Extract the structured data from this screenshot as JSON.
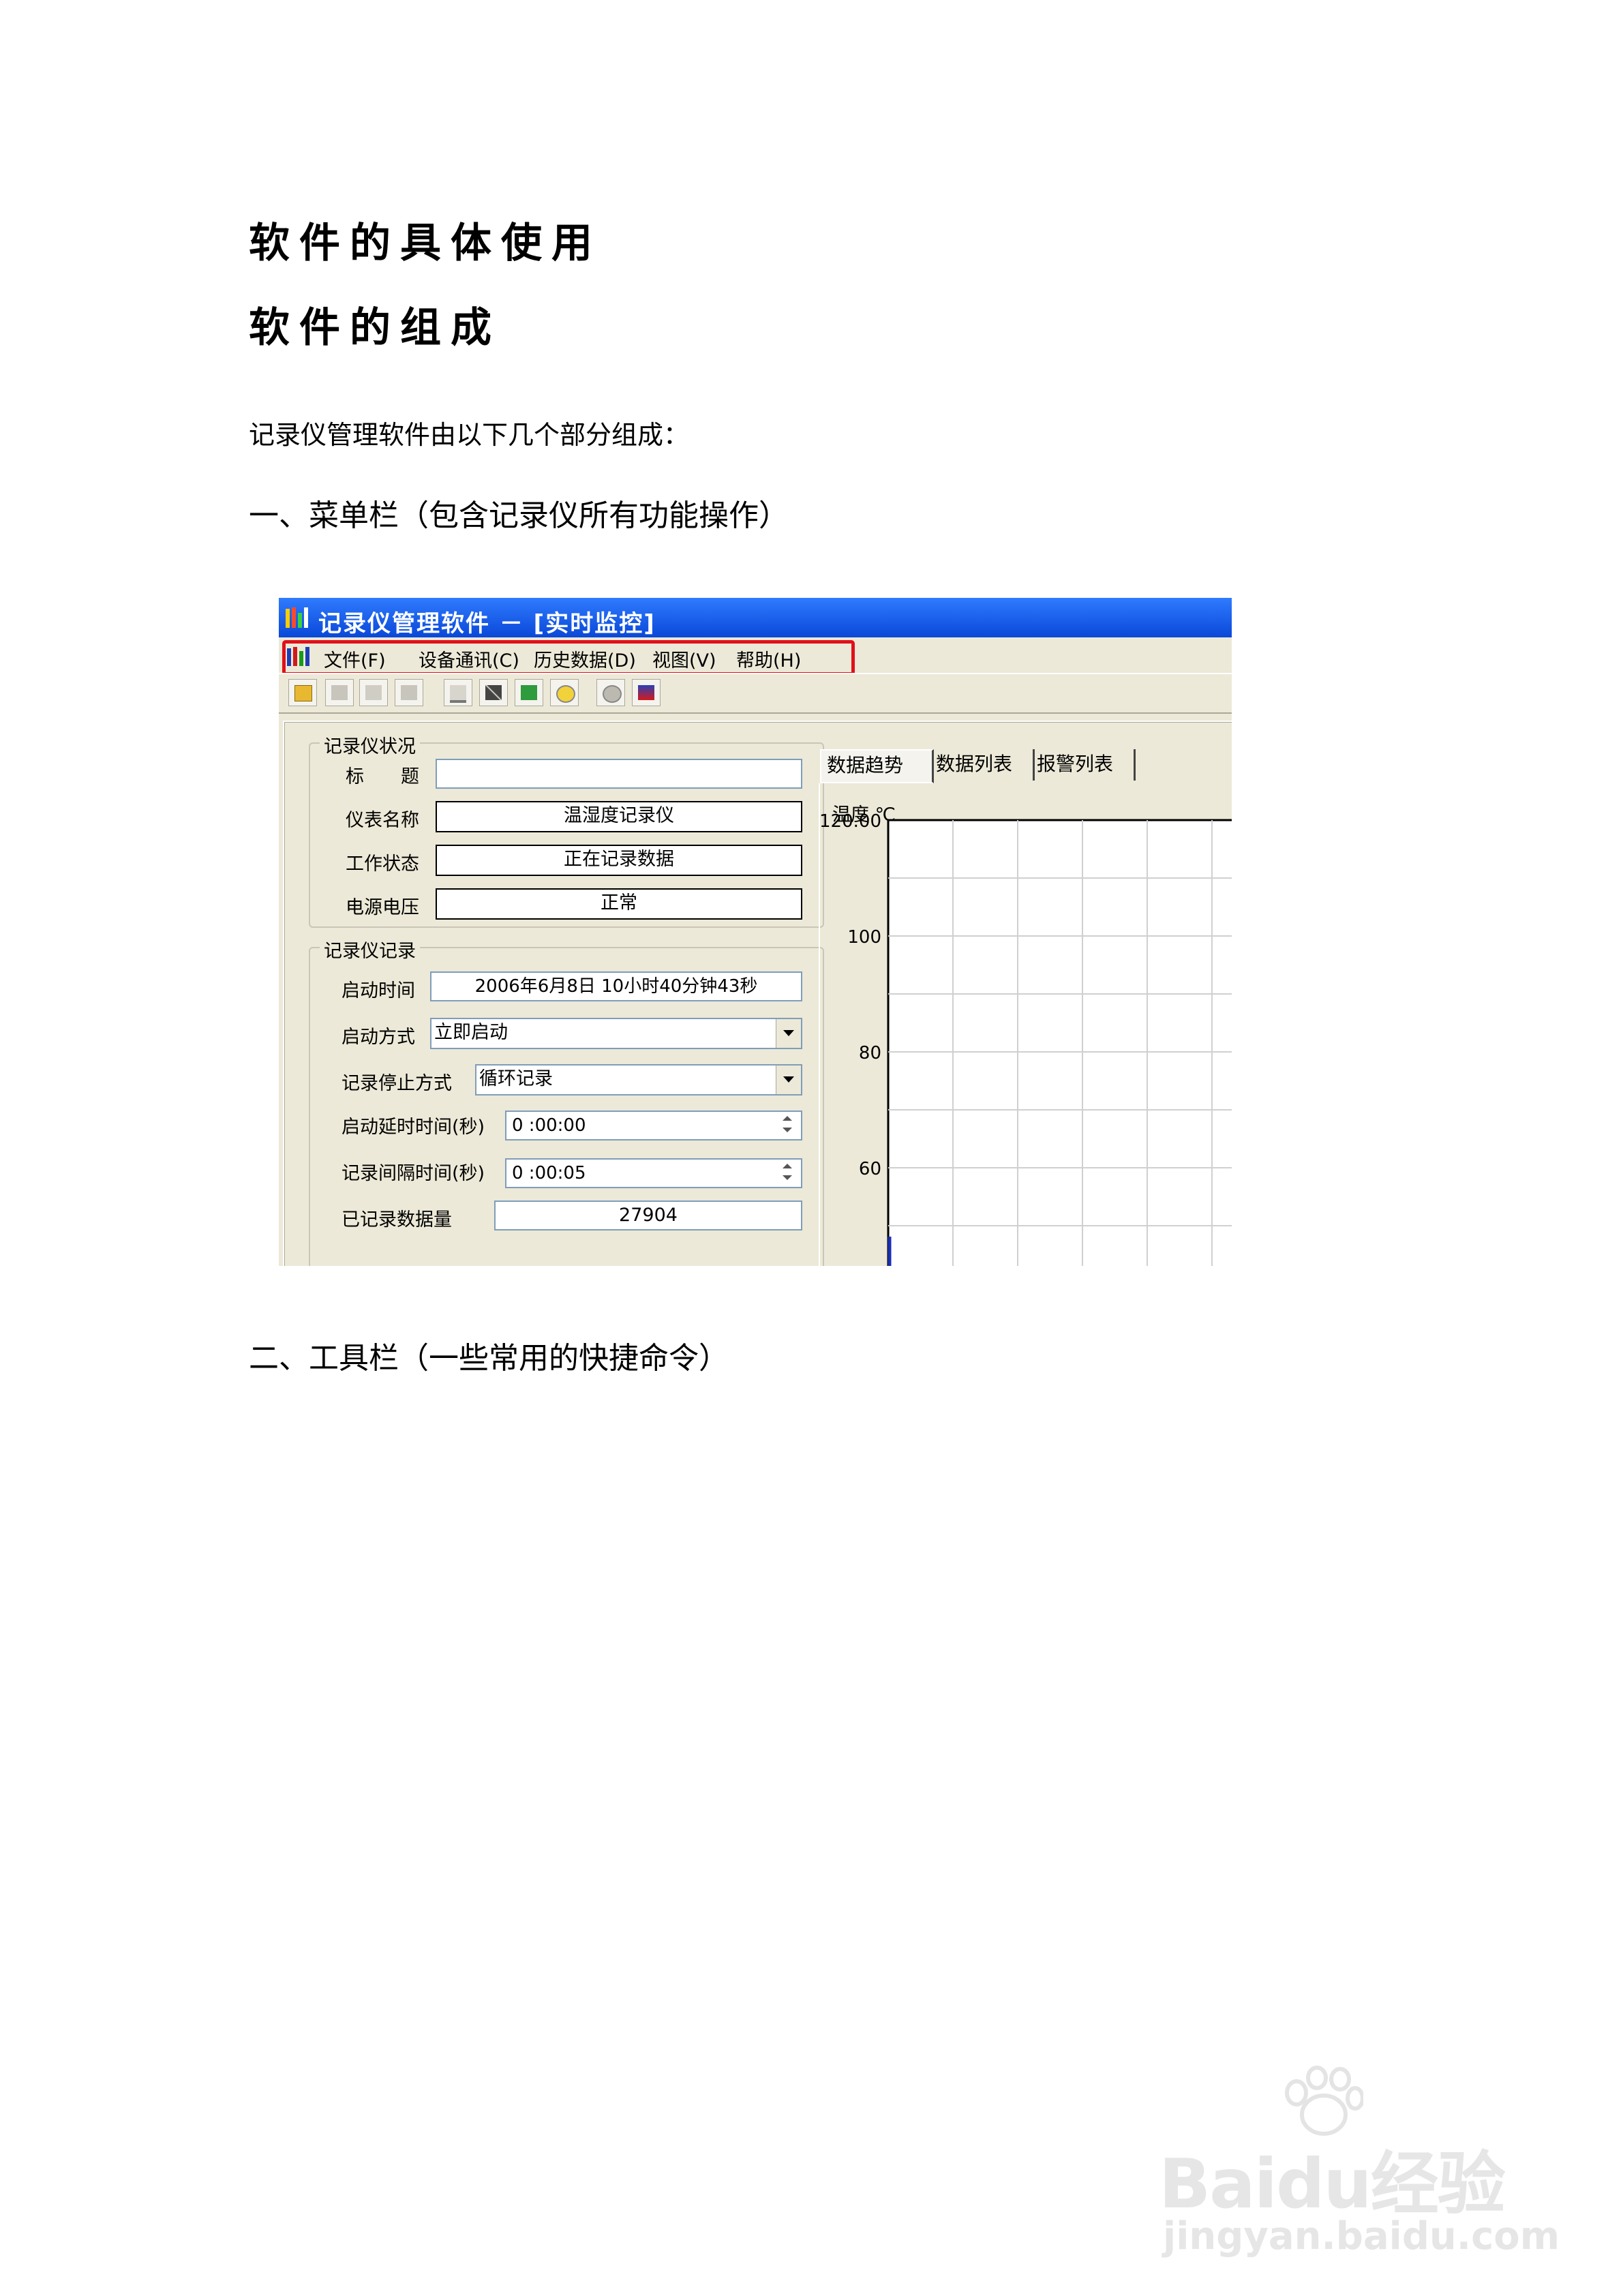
{
  "doc": {
    "heading1": "软件的具体使用",
    "heading2": "软件的组成",
    "intro": "记录仪管理软件由以下几个部分组成：",
    "section1": "一、菜单栏（包含记录仪所有功能操作）",
    "section2": "二、工具栏（一些常用的快捷命令）"
  },
  "app": {
    "window_title": "记录仪管理软件 － [实时监控]",
    "menu": [
      "文件(F)",
      "设备通讯(C)",
      "历史数据(D)",
      "视图(V)",
      "帮助(H)"
    ],
    "toolbar_icons": [
      "open-icon",
      "save-icon",
      "copy-icon",
      "print-icon",
      "window-icon",
      "tools-icon",
      "network-icon",
      "settings-icon",
      "gear-icon",
      "signal-icon"
    ],
    "status_group": {
      "title": "记录仪状况",
      "rows": [
        {
          "label": "标　　题",
          "value": ""
        },
        {
          "label": "仪表名称",
          "value": "温湿度记录仪"
        },
        {
          "label": "工作状态",
          "value": "正在记录数据"
        },
        {
          "label": "电源电压",
          "value": "正常"
        }
      ]
    },
    "record_group": {
      "title": "记录仪记录",
      "start_time_label": "启动时间",
      "start_time_value": "2006年6月8日 10小时40分钟43秒",
      "start_mode_label": "启动方式",
      "start_mode_value": "立即启动",
      "stop_mode_label": "记录停止方式",
      "stop_mode_value": "循环记录",
      "delay_label": "启动延时时间(秒)",
      "delay_value": "0 :00:00",
      "interval_label": "记录间隔时间(秒)",
      "interval_value": "0 :00:05",
      "count_label": "已记录数据量",
      "count_value": "27904"
    },
    "tabs": [
      "数据趋势",
      "数据列表",
      "报警列表"
    ],
    "active_tab": "数据趋势",
    "chart_axis_title": "温度 ℃",
    "highlight_color": "#e0101a"
  },
  "chart_data": {
    "type": "line",
    "ylabel": "温度 ℃",
    "y_ticks": [
      "120.00",
      "100",
      "80",
      "60"
    ],
    "ylim": [
      60,
      120
    ],
    "grid": true,
    "series": []
  },
  "watermark": {
    "brand": "Baidu经验",
    "url": "jingyan.baidu.com"
  }
}
